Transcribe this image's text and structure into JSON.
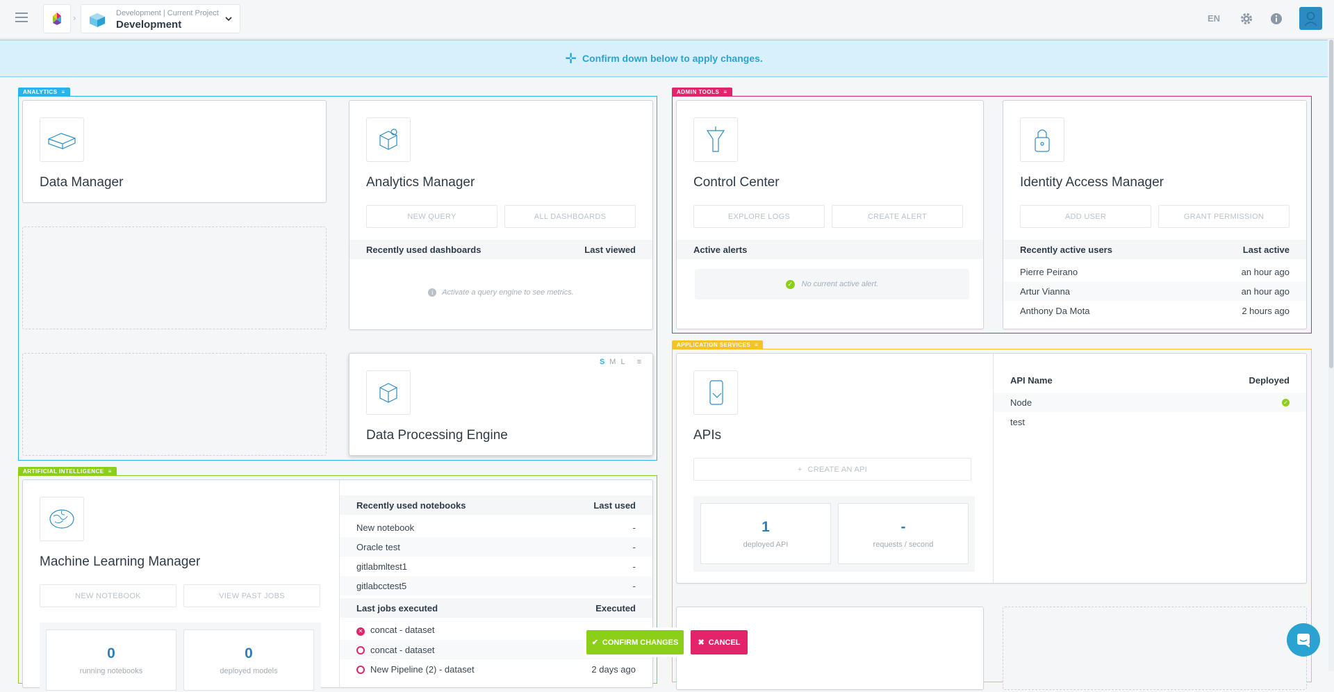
{
  "topbar": {
    "project_sub": "Development | Current Project",
    "project_name": "Development",
    "lang": "EN",
    "icons": [
      "menu-icon",
      "app-logo-icon",
      "project-icon",
      "chevron-down-icon",
      "gear-icon",
      "info-icon",
      "user-icon"
    ]
  },
  "banner": {
    "text": "Confirm down below to apply changes."
  },
  "groups": {
    "analytics": "ANALYTICS",
    "admin": "ADMIN TOOLS",
    "app": "APPLICATION SERVICES",
    "ai": "ARTIFICIAL INTELLIGENCE"
  },
  "data_manager": {
    "title": "Data Manager"
  },
  "analytics_manager": {
    "title": "Analytics Manager",
    "btn1": "NEW QUERY",
    "btn2": "ALL DASHBOARDS",
    "col1": "Recently used dashboards",
    "col2": "Last viewed",
    "empty": "Activate a query engine to see metrics."
  },
  "dpe": {
    "title": "Data Processing Engine",
    "sizes": [
      "S",
      "M",
      "L"
    ]
  },
  "control_center": {
    "title": "Control Center",
    "btn1": "EXPLORE LOGS",
    "btn2": "CREATE ALERT",
    "col1": "Active alerts",
    "empty": "No current active alert."
  },
  "iam": {
    "title": "Identity Access Manager",
    "btn1": "ADD USER",
    "btn2": "GRANT PERMISSION",
    "col1": "Recently active users",
    "col2": "Last active",
    "rows": [
      {
        "name": "Pierre Peirano",
        "time": "an hour ago"
      },
      {
        "name": "Artur Vianna",
        "time": "an hour ago"
      },
      {
        "name": "Anthony Da Mota",
        "time": "2 hours ago"
      }
    ]
  },
  "apis": {
    "title": "APIs",
    "create": "CREATE AN API",
    "stat1_val": "1",
    "stat1_lab": "deployed API",
    "stat2_val": "-",
    "stat2_lab": "requests / second",
    "col1": "API Name",
    "col2": "Deployed",
    "rows": [
      {
        "name": "Node",
        "deployed": true
      },
      {
        "name": "test",
        "deployed": false
      }
    ]
  },
  "mlm": {
    "title": "Machine Learning Manager",
    "btn1": "NEW NOTEBOOK",
    "btn2": "VIEW PAST JOBS",
    "stat1_val": "0",
    "stat1_lab": "running notebooks",
    "stat2_val": "0",
    "stat2_lab": "deployed models",
    "nb_col1": "Recently used notebooks",
    "nb_col2": "Last used",
    "notebooks": [
      {
        "name": "New notebook",
        "used": "-"
      },
      {
        "name": "Oracle test",
        "used": "-"
      },
      {
        "name": "gitlabmltest1",
        "used": "-"
      },
      {
        "name": "gitlabcctest5",
        "used": "-"
      }
    ],
    "jobs_col1": "Last jobs executed",
    "jobs_col2": "Executed",
    "jobs": [
      {
        "name": "concat - dataset",
        "executed": ""
      },
      {
        "name": "concat - dataset",
        "executed": ""
      },
      {
        "name": "New Pipeline (2) - dataset",
        "executed": "2 days ago"
      }
    ]
  },
  "actions": {
    "confirm": "CONFIRM CHANGES",
    "cancel": "CANCEL"
  },
  "colors": {
    "analytics": "#29b4e8",
    "admin": "#e2246b",
    "app": "#f5c227",
    "ai": "#8ccf19",
    "confirm": "#8ccf19",
    "cancel": "#e2246b"
  }
}
